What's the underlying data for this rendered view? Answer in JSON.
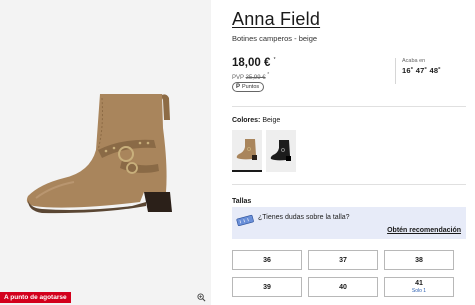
{
  "product": {
    "brand": "Anna Field",
    "subtitle": "Botines camperos - beige",
    "price": "18,00 €",
    "price_marker": "*",
    "pvp_label": "PVP",
    "pvp_value": "35,99 €",
    "pvp_marker": "*",
    "points_label": "Puntos",
    "points_icon": "P"
  },
  "countdown": {
    "label": "Acaba en",
    "time": "16˚ 47˚ 48˚"
  },
  "image": {
    "stock_badge": "A punto de agotarse"
  },
  "colors": {
    "label": "Colores:",
    "selected": "Beige",
    "swatches": [
      {
        "name": "beige",
        "color": "#a9855c"
      },
      {
        "name": "black",
        "color": "#1c1c1c"
      }
    ]
  },
  "sizes": {
    "label": "Tallas",
    "help_question": "¿Tienes dudas sobre la talla?",
    "help_link": "Obtén recomendación",
    "options": [
      {
        "size": "36",
        "stock": ""
      },
      {
        "size": "37",
        "stock": ""
      },
      {
        "size": "38",
        "stock": ""
      },
      {
        "size": "39",
        "stock": ""
      },
      {
        "size": "40",
        "stock": ""
      },
      {
        "size": "41",
        "stock": "Solo 1"
      }
    ]
  },
  "theme": {
    "accent_red": "#d3001c",
    "help_bg": "#e7ebf8",
    "boot_color": "#a9855c"
  }
}
